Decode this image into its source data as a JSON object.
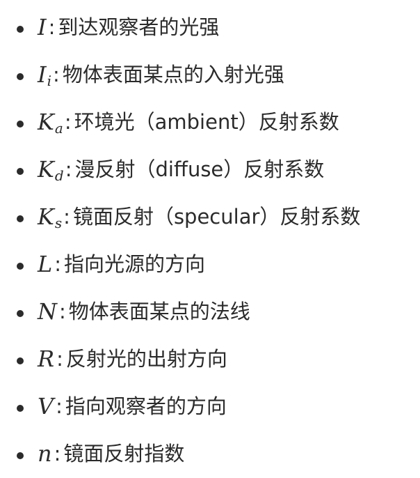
{
  "items": [
    {
      "symbol": "I",
      "sub": "",
      "sep": ":",
      "text": "到达观察者的光强"
    },
    {
      "symbol": "I",
      "sub": "i",
      "sep": ":",
      "text": "物体表面某点的入射光强"
    },
    {
      "symbol": "K",
      "sub": "a",
      "sep": ":",
      "text": "环境光（ambient）反射系数"
    },
    {
      "symbol": "K",
      "sub": "d",
      "sep": ":",
      "text": "漫反射（diffuse）反射系数"
    },
    {
      "symbol": "K",
      "sub": "s",
      "sep": ":",
      "text": "镜面反射（specular）反射系数"
    },
    {
      "symbol": "L",
      "sub": "",
      "sep": ":",
      "text": "指向光源的方向"
    },
    {
      "symbol": "N",
      "sub": "",
      "sep": ":",
      "text": "物体表面某点的法线"
    },
    {
      "symbol": "R",
      "sub": "",
      "sep": ":",
      "text": "反射光的出射方向"
    },
    {
      "symbol": "V",
      "sub": "",
      "sep": ":",
      "text": "指向观察者的方向"
    },
    {
      "symbol": "n",
      "sub": "",
      "sep": ":",
      "text": "镜面反射指数"
    }
  ]
}
